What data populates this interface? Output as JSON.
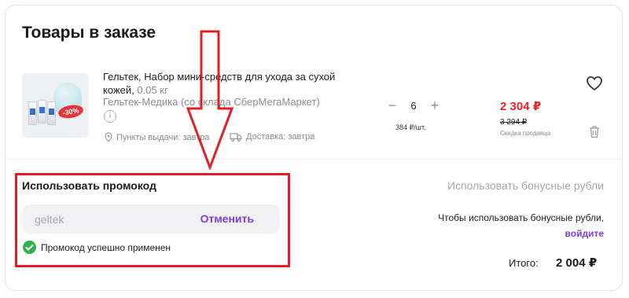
{
  "cart": {
    "title": "Товары в заказе",
    "product": {
      "name": "Гельтек, Набор мини-средств для ухода за сухой кожей,",
      "weight": "0.05 кг",
      "seller": "Гельтек-Медика (со склада СберМегаМаркет)",
      "image_badge": "-30%",
      "pickup": "Пункты выдачи: завтра",
      "delivery": "Доставка: завтра",
      "quantity": "6",
      "unit_price": "384 ₽/шт.",
      "price": "2 304 ₽",
      "old_price": "3 294 ₽",
      "discount_note": "Скидка продавца"
    }
  },
  "promo": {
    "title": "Использовать промокод",
    "code_value": "geltek",
    "cancel_label": "Отменить",
    "success_message": "Промокод успешно применен"
  },
  "bonus": {
    "title": "Использовать бонусные рубли",
    "text": "Чтобы использовать бонусные рубли,",
    "login_label": "войдите"
  },
  "total": {
    "label": "Итого:",
    "value": "2 004 ₽"
  },
  "colors": {
    "accent": "#7b3fe4",
    "price_red": "#e5262e",
    "success": "#2fb24c",
    "annotation_red": "#e51e25"
  }
}
